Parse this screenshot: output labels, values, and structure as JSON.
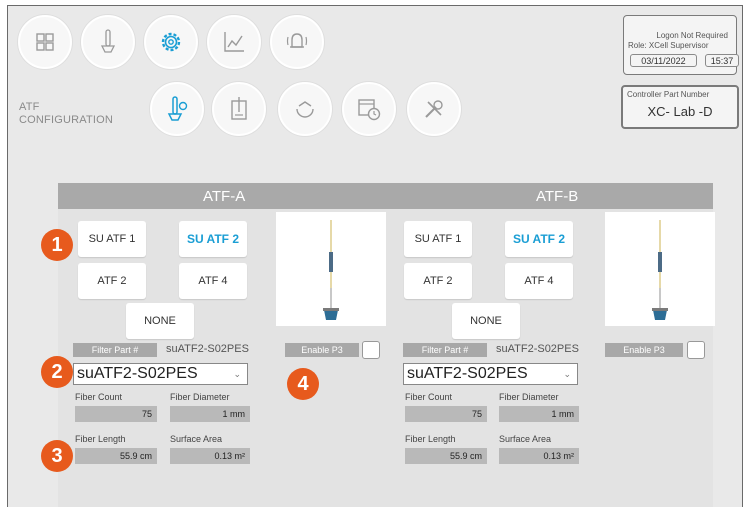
{
  "nav": {
    "top": [
      {
        "name": "grid-icon"
      },
      {
        "name": "probe-icon"
      },
      {
        "name": "gear-icon"
      },
      {
        "name": "chart-icon"
      },
      {
        "name": "bell-icon"
      }
    ],
    "sub": [
      {
        "name": "atf-config-icon"
      },
      {
        "name": "vessel-icon"
      },
      {
        "name": "cycle-icon"
      },
      {
        "name": "calendar-clock-icon"
      },
      {
        "name": "tools-icon"
      }
    ],
    "accent_color": "#1a9ed4"
  },
  "breadcrumb": {
    "line1": "ATF",
    "line2": "CONFIGURATION"
  },
  "status": {
    "logon": "Logon Not Required",
    "role": "Role: XCell Supervisor",
    "date": "03/11/2022",
    "time": "15:37"
  },
  "controller": {
    "label": "Controller Part Number",
    "value": "XC- Lab -D"
  },
  "atf_a": {
    "title": "ATF-A",
    "buttons": [
      "SU ATF 1",
      "SU ATF 2",
      "ATF 2",
      "ATF 4",
      "NONE"
    ],
    "selected": "SU ATF 2",
    "filter_part_label": "Filter Part #",
    "filter_part_value": "suATF2-S02PES",
    "select_value": "suATF2-S02PES",
    "enable_p3": "Enable P3",
    "fiber_count_label": "Fiber Count",
    "fiber_count": "75",
    "fiber_diameter_label": "Fiber Diameter",
    "fiber_diameter": "1 mm",
    "fiber_length_label": "Fiber Length",
    "fiber_length": "55.9 cm",
    "surface_area_label": "Surface Area",
    "surface_area": "0.13 m²"
  },
  "atf_b": {
    "title": "ATF-B",
    "buttons": [
      "SU ATF 1",
      "SU ATF 2",
      "ATF 2",
      "ATF 4",
      "NONE"
    ],
    "selected": "SU ATF 2",
    "filter_part_label": "Filter Part #",
    "filter_part_value": "suATF2-S02PES",
    "select_value": "suATF2-S02PES",
    "enable_p3": "Enable P3",
    "fiber_count_label": "Fiber Count",
    "fiber_count": "75",
    "fiber_diameter_label": "Fiber Diameter",
    "fiber_diameter": "1 mm",
    "fiber_length_label": "Fiber Length",
    "fiber_length": "55.9 cm",
    "surface_area_label": "Surface Area",
    "surface_area": "0.13 m²"
  },
  "callouts": {
    "one": "1",
    "two": "2",
    "three": "3",
    "four": "4",
    "color": "#e75a1d"
  }
}
